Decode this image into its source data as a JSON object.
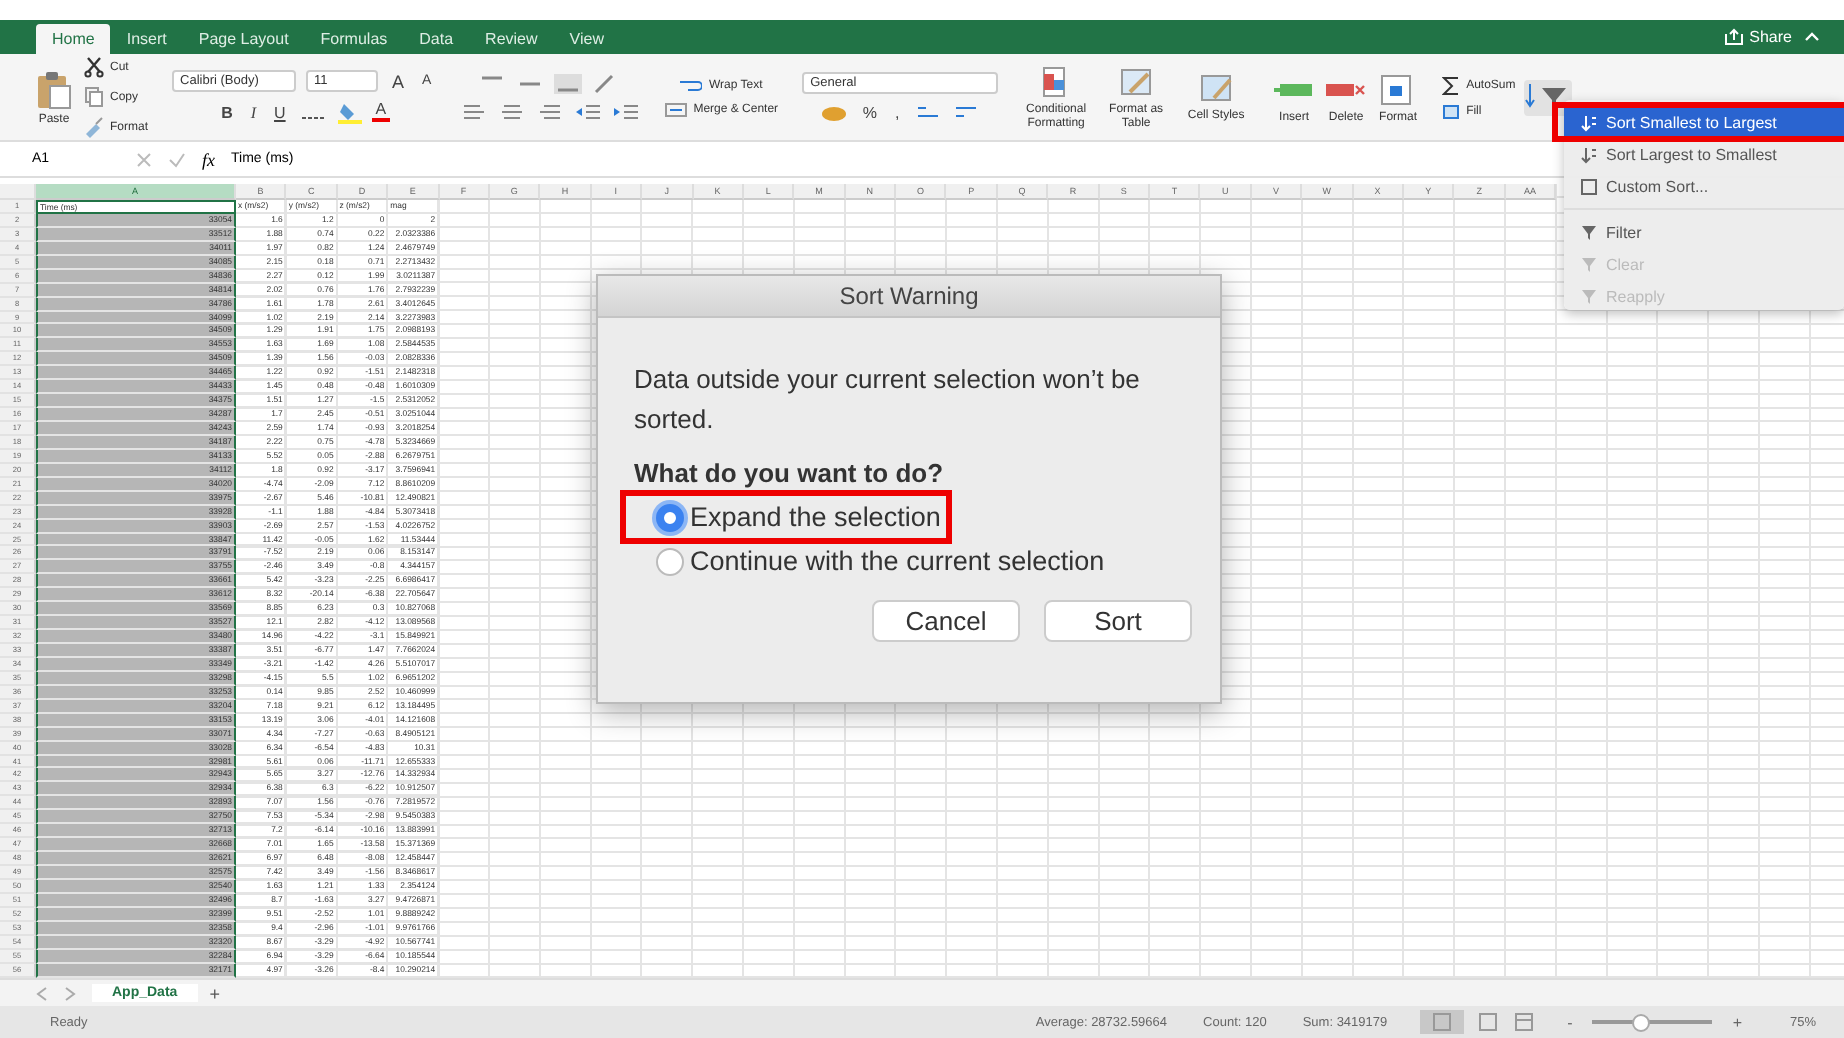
{
  "tabs": [
    {
      "label": "Home",
      "selected": true
    },
    {
      "label": "Insert",
      "selected": false
    },
    {
      "label": "Page Layout",
      "selected": false
    },
    {
      "label": "Formulas",
      "selected": false
    },
    {
      "label": "Data",
      "selected": false
    },
    {
      "label": "Review",
      "selected": false
    },
    {
      "label": "View",
      "selected": false
    }
  ],
  "share": "Share",
  "ribbon": {
    "clipboard": {
      "paste": "Paste",
      "cut": "Cut",
      "copy": "Copy",
      "format": "Format"
    },
    "font": {
      "name": "Calibri (Body)",
      "size": "11",
      "grow": "A",
      "shrink": "A",
      "bold": "B",
      "italic": "I",
      "underline": "U",
      "font_color_button": "A"
    },
    "alignment": {
      "wrap_text": "Wrap Text",
      "merge_center": "Merge & Center"
    },
    "number": {
      "format": "General",
      "percent": "%",
      "comma": ","
    },
    "styles": [
      "Conditional Formatting",
      "Format as Table",
      "Cell Styles"
    ],
    "cells": [
      "Insert",
      "Delete",
      "Format"
    ],
    "editing": {
      "autosum": "AutoSum",
      "fill": "Fill"
    }
  },
  "formula_bar": {
    "cell": "A1",
    "fx": "fx",
    "content": "Time (ms)"
  },
  "sheet": {
    "columns": [
      {
        "letter": "A",
        "selected": true
      },
      {
        "letter": "B",
        "selected": false
      },
      {
        "letter": "C",
        "selected": false
      },
      {
        "letter": "D",
        "selected": false
      },
      {
        "letter": "E",
        "selected": false
      },
      {
        "letter": "F",
        "selected": false
      },
      {
        "letter": "G",
        "selected": false
      },
      {
        "letter": "H",
        "selected": false
      },
      {
        "letter": "I",
        "selected": false
      },
      {
        "letter": "J",
        "selected": false
      },
      {
        "letter": "K",
        "selected": false
      },
      {
        "letter": "L",
        "selected": false
      },
      {
        "letter": "M",
        "selected": false
      },
      {
        "letter": "N",
        "selected": false
      },
      {
        "letter": "O",
        "selected": false
      },
      {
        "letter": "P",
        "selected": false
      },
      {
        "letter": "Q",
        "selected": false
      },
      {
        "letter": "R",
        "selected": false
      },
      {
        "letter": "S",
        "selected": false
      },
      {
        "letter": "T",
        "selected": false
      },
      {
        "letter": "U",
        "selected": false
      },
      {
        "letter": "V",
        "selected": false
      },
      {
        "letter": "W",
        "selected": false
      },
      {
        "letter": "X",
        "selected": false
      },
      {
        "letter": "Y",
        "selected": false
      },
      {
        "letter": "Z",
        "selected": false
      },
      {
        "letter": "AA",
        "selected": false
      }
    ],
    "header_row": {
      "number": "1",
      "cells": [
        "Time (ms)",
        "x (m/s2)",
        "y (m/s2)",
        "z (m/s2)",
        "mag"
      ]
    },
    "rows": [
      {
        "number": "2",
        "cells": [
          "33054",
          "1.6",
          "1.2",
          "0",
          "2"
        ]
      },
      {
        "number": "3",
        "cells": [
          "33512",
          "1.88",
          "0.74",
          "0.22",
          "2.0323386"
        ]
      },
      {
        "number": "4",
        "cells": [
          "34011",
          "1.97",
          "0.82",
          "1.24",
          "2.4679749"
        ]
      },
      {
        "number": "5",
        "cells": [
          "34085",
          "2.15",
          "0.18",
          "0.71",
          "2.2713432"
        ]
      },
      {
        "number": "6",
        "cells": [
          "34836",
          "2.27",
          "0.12",
          "1.99",
          "3.0211387"
        ]
      },
      {
        "number": "7",
        "cells": [
          "34814",
          "2.02",
          "0.76",
          "1.76",
          "2.7932239"
        ]
      },
      {
        "number": "8",
        "cells": [
          "34786",
          "1.61",
          "1.78",
          "2.61",
          "3.4012645"
        ]
      },
      {
        "number": "9",
        "cells": [
          "34099",
          "1.02",
          "2.19",
          "2.14",
          "3.2273983"
        ]
      },
      {
        "number": "10",
        "cells": [
          "34509",
          "1.29",
          "1.91",
          "1.75",
          "2.0988193"
        ]
      },
      {
        "number": "11",
        "cells": [
          "34553",
          "1.63",
          "1.69",
          "1.08",
          "2.5844535"
        ]
      },
      {
        "number": "12",
        "cells": [
          "34509",
          "1.39",
          "1.56",
          "-0.03",
          "2.0828336"
        ]
      },
      {
        "number": "13",
        "cells": [
          "34465",
          "1.22",
          "0.92",
          "-1.51",
          "2.1482318"
        ]
      },
      {
        "number": "14",
        "cells": [
          "34433",
          "1.45",
          "0.48",
          "-0.48",
          "1.6010309"
        ]
      },
      {
        "number": "15",
        "cells": [
          "34375",
          "1.51",
          "1.27",
          "-1.5",
          "2.5312052"
        ]
      },
      {
        "number": "16",
        "cells": [
          "34287",
          "1.7",
          "2.45",
          "-0.51",
          "3.0251044"
        ]
      },
      {
        "number": "17",
        "cells": [
          "34243",
          "2.59",
          "1.74",
          "-0.93",
          "3.2018254"
        ]
      },
      {
        "number": "18",
        "cells": [
          "34187",
          "2.22",
          "0.75",
          "-4.78",
          "5.3234669"
        ]
      },
      {
        "number": "19",
        "cells": [
          "34133",
          "5.52",
          "0.05",
          "-2.88",
          "6.2679751"
        ]
      },
      {
        "number": "20",
        "cells": [
          "34112",
          "1.8",
          "0.92",
          "-3.17",
          "3.7596941"
        ]
      },
      {
        "number": "21",
        "cells": [
          "34020",
          "-4.74",
          "-2.09",
          "7.12",
          "8.8610209"
        ]
      },
      {
        "number": "22",
        "cells": [
          "33975",
          "-2.67",
          "5.46",
          "-10.81",
          "12.490821"
        ]
      },
      {
        "number": "23",
        "cells": [
          "33928",
          "-1.1",
          "1.88",
          "-4.84",
          "5.3073418"
        ]
      },
      {
        "number": "24",
        "cells": [
          "33903",
          "-2.69",
          "2.57",
          "-1.53",
          "4.0226752"
        ]
      },
      {
        "number": "25",
        "cells": [
          "33847",
          "11.42",
          "-0.05",
          "1.62",
          "11.53444"
        ]
      },
      {
        "number": "26",
        "cells": [
          "33791",
          "-7.52",
          "2.19",
          "0.06",
          "8.153147"
        ]
      },
      {
        "number": "27",
        "cells": [
          "33755",
          "-2.46",
          "3.49",
          "-0.8",
          "4.344157"
        ]
      },
      {
        "number": "28",
        "cells": [
          "33661",
          "5.42",
          "-3.23",
          "-2.25",
          "6.6986417"
        ]
      },
      {
        "number": "29",
        "cells": [
          "33612",
          "8.32",
          "-20.14",
          "-6.38",
          "22.705647"
        ]
      },
      {
        "number": "30",
        "cells": [
          "33569",
          "8.85",
          "6.23",
          "0.3",
          "10.827068"
        ]
      },
      {
        "number": "31",
        "cells": [
          "33527",
          "12.1",
          "2.82",
          "-4.12",
          "13.089568"
        ]
      },
      {
        "number": "32",
        "cells": [
          "33480",
          "14.96",
          "-4.22",
          "-3.1",
          "15.849921"
        ]
      },
      {
        "number": "33",
        "cells": [
          "33387",
          "3.51",
          "-6.77",
          "1.47",
          "7.7662024"
        ]
      },
      {
        "number": "34",
        "cells": [
          "33349",
          "-3.21",
          "-1.42",
          "4.26",
          "5.5107017"
        ]
      },
      {
        "number": "35",
        "cells": [
          "33298",
          "-4.15",
          "5.5",
          "1.02",
          "6.9651202"
        ]
      },
      {
        "number": "36",
        "cells": [
          "33253",
          "0.14",
          "9.85",
          "2.52",
          "10.460999"
        ]
      },
      {
        "number": "37",
        "cells": [
          "33204",
          "7.18",
          "9.21",
          "6.12",
          "13.184495"
        ]
      },
      {
        "number": "38",
        "cells": [
          "33153",
          "13.19",
          "3.06",
          "-4.01",
          "14.121608"
        ]
      },
      {
        "number": "39",
        "cells": [
          "33071",
          "4.34",
          "-7.27",
          "-0.63",
          "8.4905121"
        ]
      },
      {
        "number": "40",
        "cells": [
          "33028",
          "6.34",
          "-6.54",
          "-4.83",
          "10.31"
        ]
      },
      {
        "number": "41",
        "cells": [
          "32981",
          "5.61",
          "0.06",
          "-11.71",
          "12.655333"
        ]
      },
      {
        "number": "42",
        "cells": [
          "32943",
          "5.65",
          "3.27",
          "-12.76",
          "14.332934"
        ]
      },
      {
        "number": "43",
        "cells": [
          "32934",
          "6.38",
          "6.3",
          "-6.22",
          "10.912507"
        ]
      },
      {
        "number": "44",
        "cells": [
          "32893",
          "7.07",
          "1.56",
          "-0.76",
          "7.2819572"
        ]
      },
      {
        "number": "45",
        "cells": [
          "32750",
          "7.53",
          "-5.34",
          "-2.98",
          "9.5450383"
        ]
      },
      {
        "number": "46",
        "cells": [
          "32713",
          "7.2",
          "-6.14",
          "-10.16",
          "13.883991"
        ]
      },
      {
        "number": "47",
        "cells": [
          "32668",
          "7.01",
          "1.65",
          "-13.58",
          "15.371369"
        ]
      },
      {
        "number": "48",
        "cells": [
          "32621",
          "6.97",
          "6.48",
          "-8.08",
          "12.458447"
        ]
      },
      {
        "number": "49",
        "cells": [
          "32575",
          "7.42",
          "3.49",
          "-1.56",
          "8.3468617"
        ]
      },
      {
        "number": "50",
        "cells": [
          "32540",
          "1.63",
          "1.21",
          "1.33",
          "2.354124"
        ]
      },
      {
        "number": "51",
        "cells": [
          "32496",
          "8.7",
          "-1.63",
          "3.27",
          "9.4726871"
        ]
      },
      {
        "number": "52",
        "cells": [
          "32399",
          "9.51",
          "-2.52",
          "1.01",
          "9.8889242"
        ]
      },
      {
        "number": "53",
        "cells": [
          "32358",
          "9.4",
          "-2.96",
          "-1.01",
          "9.9761766"
        ]
      },
      {
        "number": "54",
        "cells": [
          "32320",
          "8.67",
          "-3.29",
          "-4.92",
          "10.567741"
        ]
      },
      {
        "number": "55",
        "cells": [
          "32284",
          "6.94",
          "-3.29",
          "-6.64",
          "10.185544"
        ]
      },
      {
        "number": "56",
        "cells": [
          "32171",
          "4.97",
          "-3.26",
          "-8.4",
          "10.290214"
        ]
      }
    ]
  },
  "sheet_tabs": [
    {
      "label": "App_Data",
      "selected": true
    }
  ],
  "add_sheet": "+",
  "status_bar": {
    "state": "Ready",
    "stats": [
      "Average: 28732.59664",
      "Count: 120",
      "Sum: 3419179"
    ],
    "zoom_minus": "-",
    "zoom_plus": "+",
    "zoom_slider": {
      "level": 0.4
    },
    "zoom": "75%"
  },
  "sort_menu": {
    "items": [
      {
        "label": "Sort Smallest to Largest",
        "selected": true,
        "disabled": false,
        "annotated": true
      },
      {
        "label": "Sort Largest to Smallest",
        "selected": false,
        "disabled": false,
        "annotated": false
      },
      {
        "label": "Custom Sort...",
        "selected": false,
        "disabled": false,
        "annotated": false
      },
      {
        "label": "Filter",
        "selected": false,
        "disabled": false,
        "annotated": false
      },
      {
        "label": "Clear",
        "selected": false,
        "disabled": true,
        "annotated": false
      },
      {
        "label": "Reapply",
        "selected": false,
        "disabled": true,
        "annotated": false
      }
    ]
  },
  "dialog": {
    "title": "Sort Warning",
    "message": "Data outside your current selection won’t be sorted.",
    "question": "What do you want to do?",
    "options": [
      {
        "label": "Expand the selection",
        "selected": true,
        "annotated": true
      },
      {
        "label": "Continue with the current selection",
        "selected": false,
        "annotated": false
      }
    ],
    "buttons": [
      "Cancel",
      "Sort"
    ]
  }
}
